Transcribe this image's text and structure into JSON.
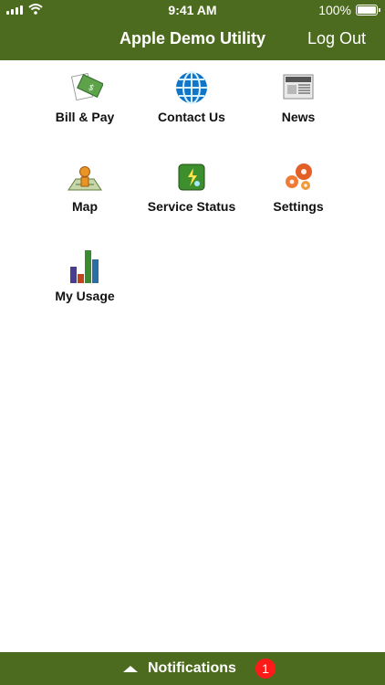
{
  "status": {
    "time": "9:41 AM",
    "battery": "100%"
  },
  "header": {
    "title": "Apple Demo Utility",
    "logout_label": "Log Out"
  },
  "tiles": [
    {
      "id": "bill-pay",
      "label": "Bill & Pay",
      "icon": "money-icon"
    },
    {
      "id": "contact-us",
      "label": "Contact Us",
      "icon": "globe-icon"
    },
    {
      "id": "news",
      "label": "News",
      "icon": "newspaper-icon"
    },
    {
      "id": "map",
      "label": "Map",
      "icon": "map-pin-icon"
    },
    {
      "id": "service-status",
      "label": "Service Status",
      "icon": "power-status-icon"
    },
    {
      "id": "settings",
      "label": "Settings",
      "icon": "gears-icon"
    },
    {
      "id": "my-usage",
      "label": "My Usage",
      "icon": "bar-chart-icon"
    }
  ],
  "footer": {
    "label": "Notifications",
    "badge_count": "1"
  },
  "colors": {
    "brand": "#4c6b1e",
    "badge": "#ff1a1a"
  }
}
